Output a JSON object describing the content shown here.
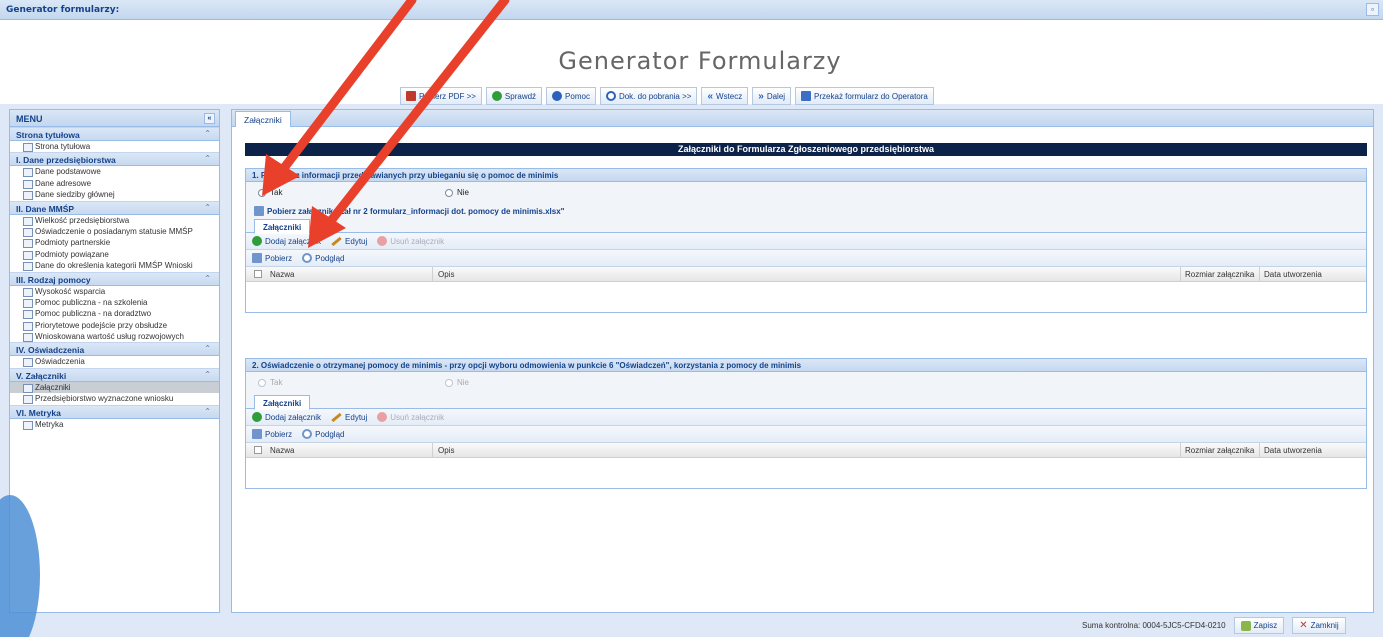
{
  "window": {
    "title": "Generator formularzy:"
  },
  "app": {
    "title": "Generator Formularzy"
  },
  "toolbar": [
    {
      "label": "Pobierz PDF >>",
      "icon": "pdf-icon"
    },
    {
      "label": "Sprawdź",
      "icon": "check-icon"
    },
    {
      "label": "Pomoc",
      "icon": "help-icon"
    },
    {
      "label": "Dok. do pobrania >>",
      "icon": "download-icon"
    },
    {
      "label": "Wstecz",
      "icon": "back-icon"
    },
    {
      "label": "Dalej",
      "icon": "next-icon"
    },
    {
      "label": "Przekaż formularz do Operatora",
      "icon": "send-icon"
    }
  ],
  "nav": {
    "title": "MENU",
    "groups": [
      {
        "title": "Strona tytułowa",
        "items": [
          "Strona tytułowa"
        ]
      },
      {
        "title": "I. Dane przedsiębiorstwa",
        "items": [
          "Dane podstawowe",
          "Dane adresowe",
          "Dane siedziby głównej"
        ]
      },
      {
        "title": "II. Dane MMŚP",
        "items": [
          "Wielkość przedsiębiorstwa",
          "Oświadczenie o posiadanym statusie MMŚP",
          "Podmioty partnerskie",
          "Podmioty powiązane",
          "Dane do określenia kategorii MMŚP Wnioski"
        ]
      },
      {
        "title": "III. Rodzaj pomocy",
        "items": [
          "Wysokość wsparcia",
          "Pomoc publiczna - na szkolenia",
          "Pomoc publiczna - na doradztwo",
          "Priorytetowe podejście przy obsłudze",
          "Wnioskowana wartość usług rozwojowych"
        ]
      },
      {
        "title": "IV. Oświadczenia",
        "items": [
          "Oświadczenia"
        ]
      },
      {
        "title": "V. Załączniki",
        "items": [
          "Załączniki",
          "Przedsiębiorstwo wyznaczone wniosku"
        ]
      },
      {
        "title": "VI. Metryka",
        "items": [
          "Metryka"
        ]
      }
    ]
  },
  "main": {
    "tab": "Załączniki",
    "banner": "Załączniki do Formularza Zgłoszeniowego przedsiębiorstwa",
    "sections": [
      {
        "title": "1. Formularz informacji przedstawianych przy ubieganiu się o pomoc de minimis",
        "radio_yes": "Tak",
        "radio_no": "Nie",
        "link": "Pobierz załącznik \"Zał nr 2 formularz_informacji dot. pomocy de minimis.xlsx\"",
        "subtab": "Załączniki",
        "add": "Dodaj załącznik",
        "edit": "Edytuj",
        "delete": "Usuń załącznik",
        "download": "Pobierz",
        "preview": "Podgląd",
        "columns": [
          "Nazwa",
          "Opis",
          "Rozmiar załącznika",
          "Data utworzenia"
        ]
      },
      {
        "title": "2. Oświadczenie o otrzymanej pomocy de minimis - przy opcji wyboru odmowienia w punkcie 6 \"Oświadczeń\", korzystania z pomocy de minimis",
        "radio_yes": "Tak",
        "radio_no": "Nie",
        "subtab": "Załączniki",
        "add": "Dodaj załącznik",
        "edit": "Edytuj",
        "delete": "Usuń załącznik",
        "download": "Pobierz",
        "preview": "Podgląd",
        "columns": [
          "Nazwa",
          "Opis",
          "Rozmiar załącznika",
          "Data utworzenia"
        ]
      }
    ]
  },
  "status": {
    "checksum": "Suma kontrolna: 0004-5JC5-CFD4-0210",
    "save": "Zapisz",
    "close": "Zamknij"
  },
  "colors": {
    "arrow": "#e8402a",
    "banner": "#0d2248",
    "accent": "#15428b"
  }
}
